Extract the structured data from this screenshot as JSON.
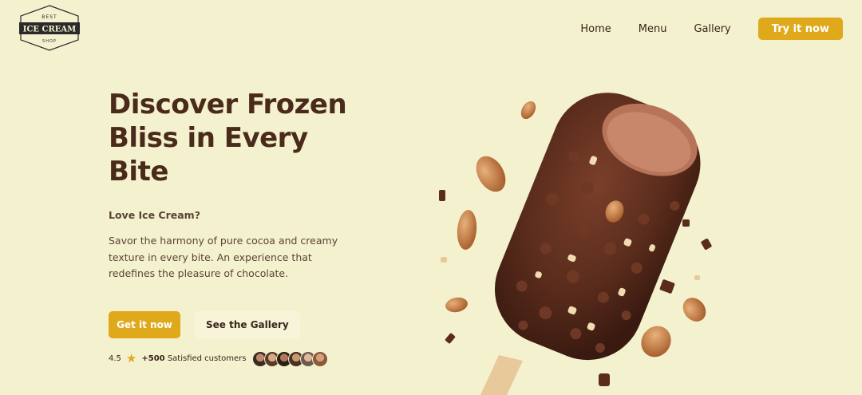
{
  "brand": {
    "top": "BEST",
    "name": "ICE CREAM",
    "bottom": "SHOP"
  },
  "nav": {
    "items": [
      "Home",
      "Menu",
      "Gallery"
    ],
    "cta": "Try it now"
  },
  "hero": {
    "title": "Discover Frozen Bliss in Every Bite",
    "subtitle": "Love Ice Cream?",
    "description": "Savor the harmony of pure cocoa and creamy texture in every bite. An experience that redefines the pleasure of chocolate.",
    "primary_button": "Get it now",
    "secondary_button": "See the Gallery",
    "rating": "4.5",
    "customers_count": "+500",
    "customers_label": "Satisfied customers",
    "avatar_count": 6
  },
  "colors": {
    "background": "#f4f1cf",
    "accent": "#e0a91b",
    "text": "#4a2a1a",
    "chocolate": "#5a2c1c"
  },
  "icons": {
    "rating": "star-icon"
  }
}
